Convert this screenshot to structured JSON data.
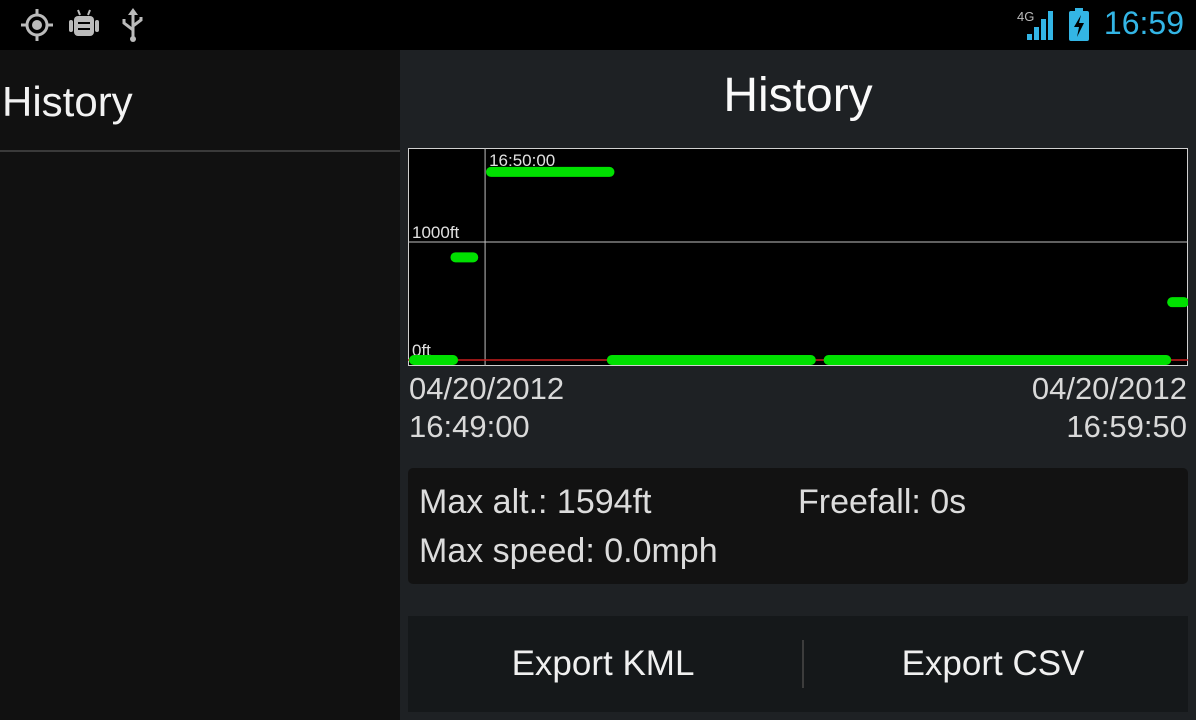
{
  "status_bar": {
    "time": "16:59",
    "network": "4G",
    "icons": [
      "gps-icon",
      "android-debug-icon",
      "usb-icon",
      "signal-icon",
      "battery-charging-icon"
    ],
    "accent_color": "#33b5e5"
  },
  "left_pane": {
    "title": "History"
  },
  "main": {
    "title": "History"
  },
  "chart_data": {
    "type": "line",
    "ylabel_ticks": [
      "1000ft",
      "0ft"
    ],
    "x_tick": "16:50:00",
    "x_range": [
      "16:49:00",
      "16:59:50"
    ],
    "ylim": [
      0,
      1600
    ],
    "line_color": "#00e000",
    "baseline_color": "#c81e1e",
    "grid": true,
    "series": [
      {
        "points": [
          {
            "t": "16:49:00",
            "alt": 0
          },
          {
            "t": "16:49:33",
            "alt": 0
          },
          {
            "t": "16:49:35",
            "alt": 870
          },
          {
            "t": "16:49:50",
            "alt": 870
          },
          {
            "t": "16:50:05",
            "alt": 1594
          },
          {
            "t": "16:51:45",
            "alt": 1594
          },
          {
            "t": "16:51:47",
            "alt": 0
          },
          {
            "t": "16:54:35",
            "alt": 0
          },
          {
            "t": "16:54:50",
            "alt": 0
          },
          {
            "t": "16:59:35",
            "alt": 0
          },
          {
            "t": "16:59:40",
            "alt": 490
          },
          {
            "t": "16:59:50",
            "alt": 490
          }
        ]
      }
    ]
  },
  "chart_range": {
    "start_date": "04/20/2012",
    "start_time": "16:49:00",
    "end_date": "04/20/2012",
    "end_time": "16:59:50"
  },
  "stats": {
    "max_alt": "Max alt.: 1594ft",
    "freefall": "Freefall: 0s",
    "max_speed": "Max speed: 0.0mph"
  },
  "buttons": {
    "export_kml": "Export KML",
    "export_csv": "Export CSV"
  }
}
